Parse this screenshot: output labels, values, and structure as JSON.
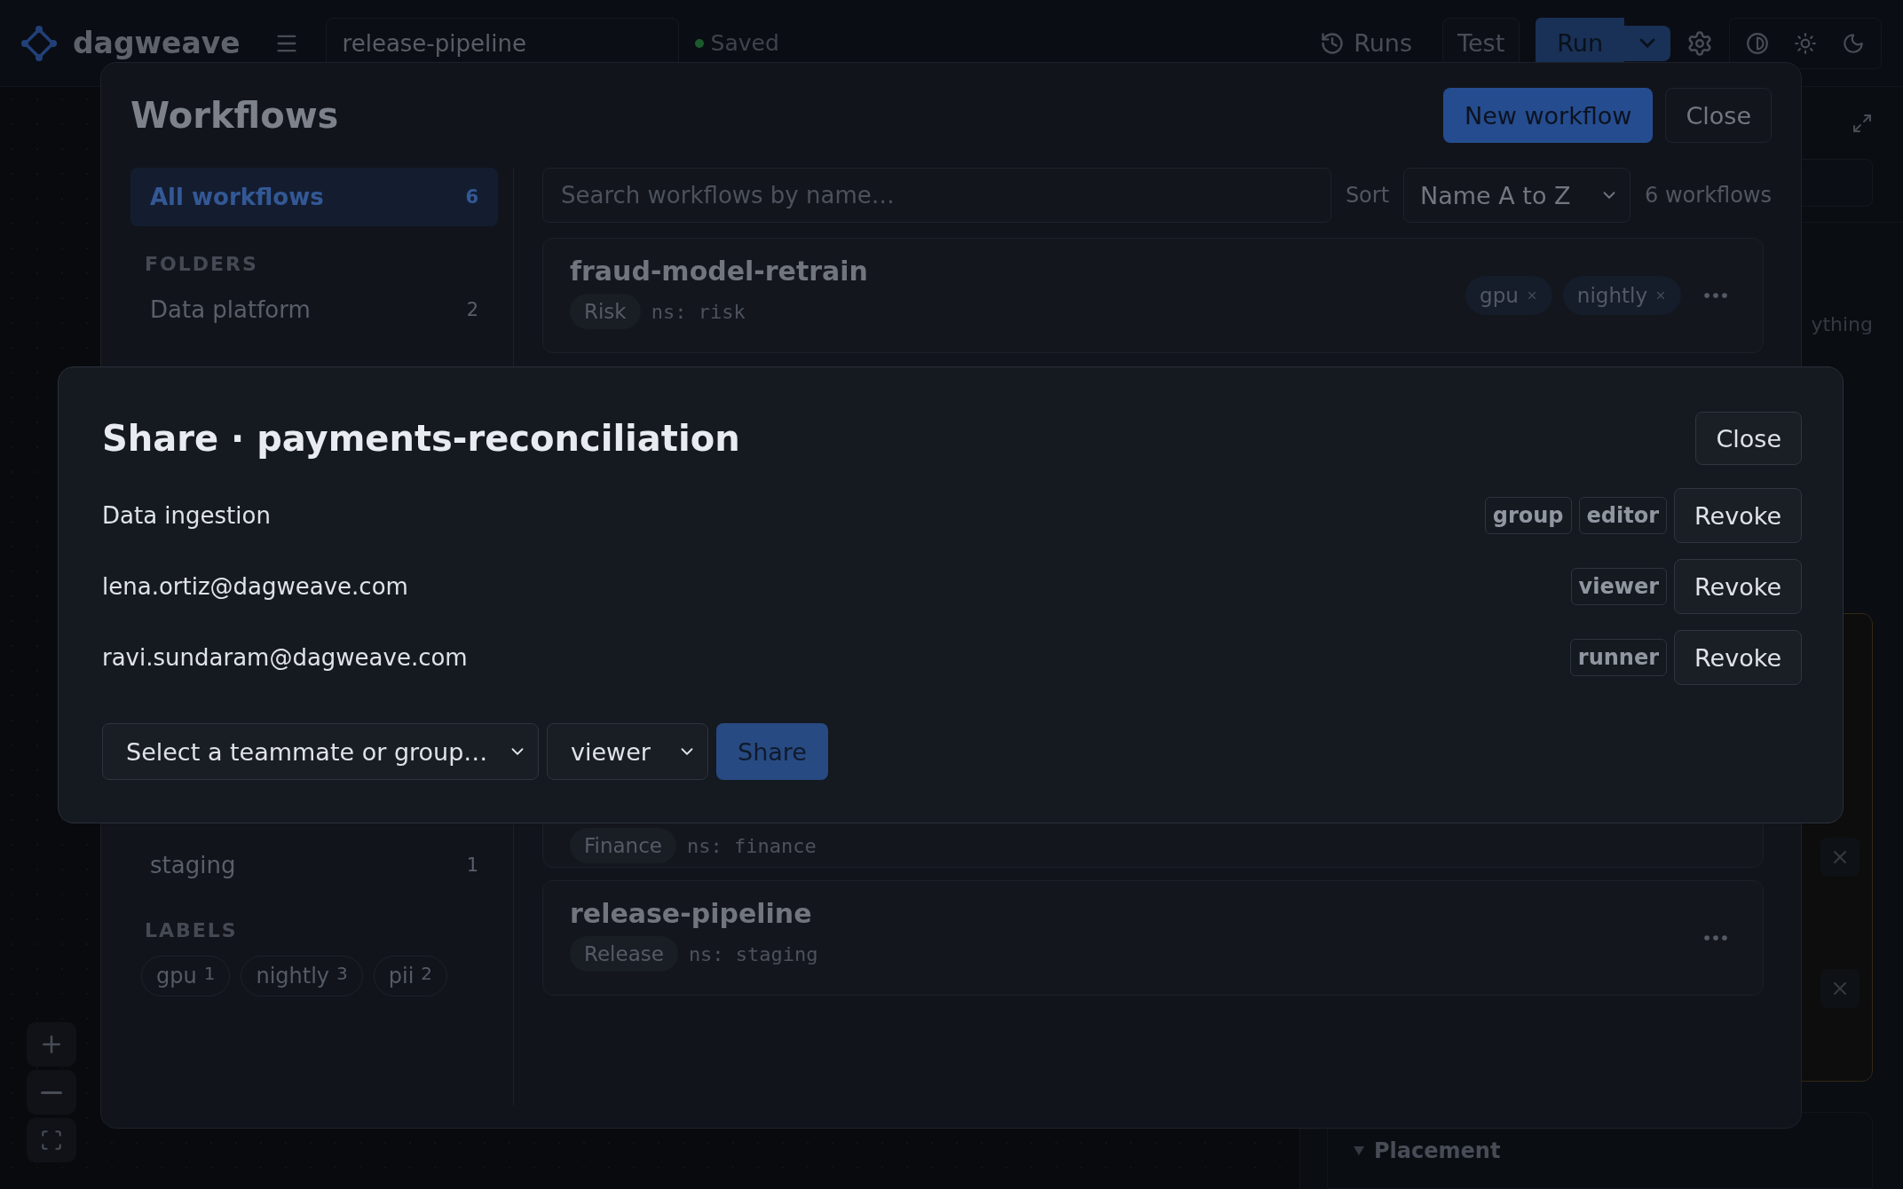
{
  "topbar": {
    "brand": "dagweave",
    "workflow_name": "release-pipeline",
    "save_status": "Saved",
    "runs_label": "Runs",
    "test_label": "Test",
    "run_label": "Run",
    "theme_modes": [
      {
        "kind": "contrast"
      },
      {
        "kind": "light"
      },
      {
        "kind": "dark"
      }
    ]
  },
  "inspector": {
    "hint_fragment": "ything",
    "section": {
      "label": "Placement",
      "expanded": true
    }
  },
  "workflows_dialog": {
    "title": "Workflows",
    "new_button": "New workflow",
    "close_button": "Close",
    "sidebar": {
      "all": {
        "label": "All workflows",
        "count": "6",
        "selected": true
      },
      "folders_heading": "FOLDERS",
      "folders": [
        {
          "label": "Data platform",
          "count": "2",
          "selected": false
        },
        {
          "label": "staging",
          "count": "1",
          "selected": false
        }
      ],
      "labels_heading": "LABELS",
      "labels": [
        {
          "name": "gpu",
          "count": "1"
        },
        {
          "name": "nightly",
          "count": "3"
        },
        {
          "name": "pii",
          "count": "2"
        }
      ]
    },
    "search": {
      "placeholder": "Search workflows by name…"
    },
    "sort_label": "Sort",
    "sort_value": "Name A to Z",
    "count_text": "6 workflows",
    "cards": [
      {
        "name": "fraud-model-retrain",
        "team": "Risk",
        "namespace": "ns: risk",
        "tags": [
          "gpu",
          "nightly"
        ]
      },
      {
        "team": "Finance",
        "namespace": "ns: finance"
      },
      {
        "name": "release-pipeline",
        "team": "Release",
        "namespace": "ns: staging"
      }
    ]
  },
  "share_dialog": {
    "title": "Share · payments-reconciliation",
    "close_button": "Close",
    "grants": [
      {
        "principal": "Data ingestion",
        "badges": [
          "group",
          "editor"
        ],
        "action": "Revoke"
      },
      {
        "principal": "lena.ortiz@dagweave.com",
        "badges": [
          "viewer"
        ],
        "action": "Revoke"
      },
      {
        "principal": "ravi.sundaram@dagweave.com",
        "badges": [
          "runner"
        ],
        "action": "Revoke"
      }
    ],
    "principal_select": "Select a teammate or group…",
    "role_select": "viewer",
    "share_button": {
      "label": "Share",
      "disabled": true
    }
  }
}
